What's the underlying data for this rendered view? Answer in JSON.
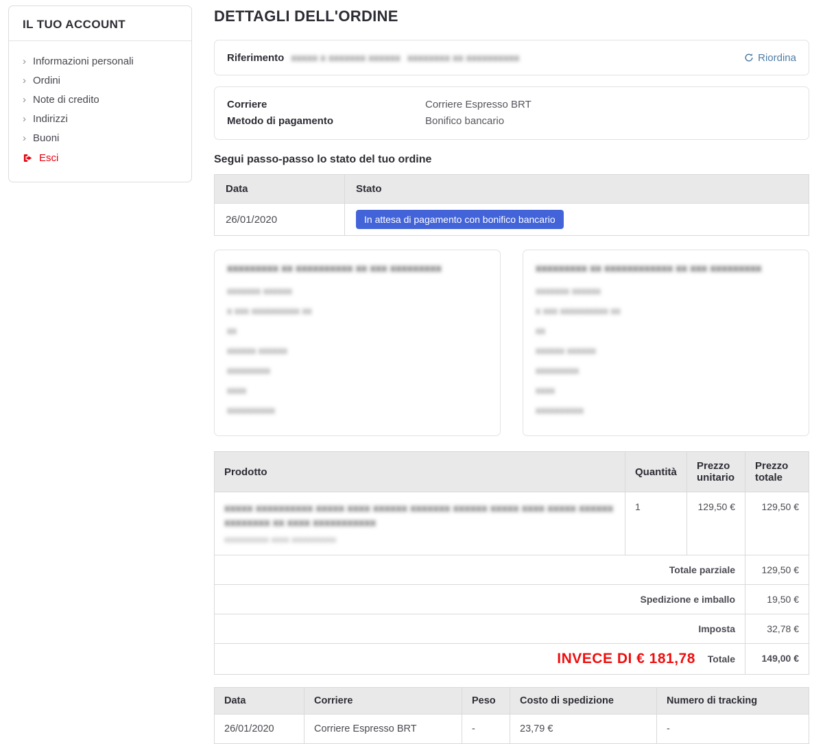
{
  "colors": {
    "badge_blue": "#4364d9",
    "link_blue": "#4d7ba4",
    "price_blue": "#4d7ba4",
    "sale_red": "#ef0e0e",
    "logout_red": "#e3000f",
    "table_header_bg": "#e9e9e9"
  },
  "sidebar": {
    "title": "IL TUO ACCOUNT",
    "chevron": "›",
    "items": [
      {
        "label": "Informazioni personali"
      },
      {
        "label": "Ordini"
      },
      {
        "label": "Note di credito"
      },
      {
        "label": "Indirizzi"
      },
      {
        "label": "Buoni"
      }
    ],
    "logout_label": "Esci"
  },
  "main": {
    "title": "DETTAGLI DELL'ORDINE",
    "reference": {
      "label": "Riferimento",
      "redacted_1": "xxxxx x xxxxxxx xxxxxx",
      "redacted_2": "xxxxxxxx xx xxxxxxxxxx",
      "reorder_label": "Riordina"
    },
    "info_box": {
      "rows": [
        {
          "label": "Corriere",
          "value": "Corriere Espresso BRT"
        },
        {
          "label": "Metodo di pagamento",
          "value": "Bonifico bancario"
        }
      ]
    },
    "status_section": {
      "heading": "Segui passo-passo lo stato del tuo ordine",
      "headers": {
        "date": "Data",
        "status": "Stato"
      },
      "rows": [
        {
          "date": "26/01/2020",
          "status_badge": "In attesa di pagamento con bonifico bancario"
        }
      ]
    },
    "addresses": {
      "shipping": {
        "title_redacted": "xxxxxxxxx xx xxxxxxxxxx xx xxx xxxxxxxxx",
        "lines": [
          "xxxxxxx xxxxxx",
          "x xxx xxxxxxxxxx xx",
          "xx",
          "xxxxxx xxxxxx",
          "xxxxxxxxx",
          "xxxx",
          "xxxxxxxxxx"
        ]
      },
      "billing": {
        "title_redacted": "xxxxxxxxx xx xxxxxxxxxxxx xx xxx xxxxxxxxx",
        "lines": [
          "xxxxxxx xxxxxx",
          "x xxx xxxxxxxxxx xx",
          "xx",
          "xxxxxx xxxxxx",
          "xxxxxxxxx",
          "xxxx",
          "xxxxxxxxxx"
        ]
      }
    },
    "product_table": {
      "headers": {
        "product": "Prodotto",
        "quantity": "Quantità",
        "unit_price": "Prezzo unitario",
        "total_price": "Prezzo totale"
      },
      "rows": [
        {
          "name_redacted_line1": "xxxxx xxxxxxxxxx xxxxx xxxx xxxxxx xxxxxxx xxxxxx xxxxx xxxx xxxxx xxxxxx",
          "name_redacted_line2": "xxxxxxxx xx xxxx xxxxxxxxxxx",
          "ref_redacted": "xxxxxxxxxx xxxx xxxxxxxxxx",
          "quantity": "1",
          "unit_price": "129,50 €",
          "total_price": "129,50 €"
        }
      ],
      "totals": [
        {
          "label": "Totale parziale",
          "value": "129,50 €"
        },
        {
          "label": "Spedizione e imballo",
          "value": "19,50 €"
        },
        {
          "label": "Imposta",
          "value": "32,78 €"
        }
      ],
      "grand_total": {
        "strike_note": "INVECE DI € 181,78",
        "label": "Totale",
        "value": "149,00 €"
      }
    },
    "shipping_table": {
      "headers": [
        "Data",
        "Corriere",
        "Peso",
        "Costo di spedizione",
        "Numero di tracking"
      ],
      "rows": [
        [
          "26/01/2020",
          "Corriere Espresso BRT",
          "-",
          "23,79 €",
          "-"
        ]
      ]
    }
  }
}
